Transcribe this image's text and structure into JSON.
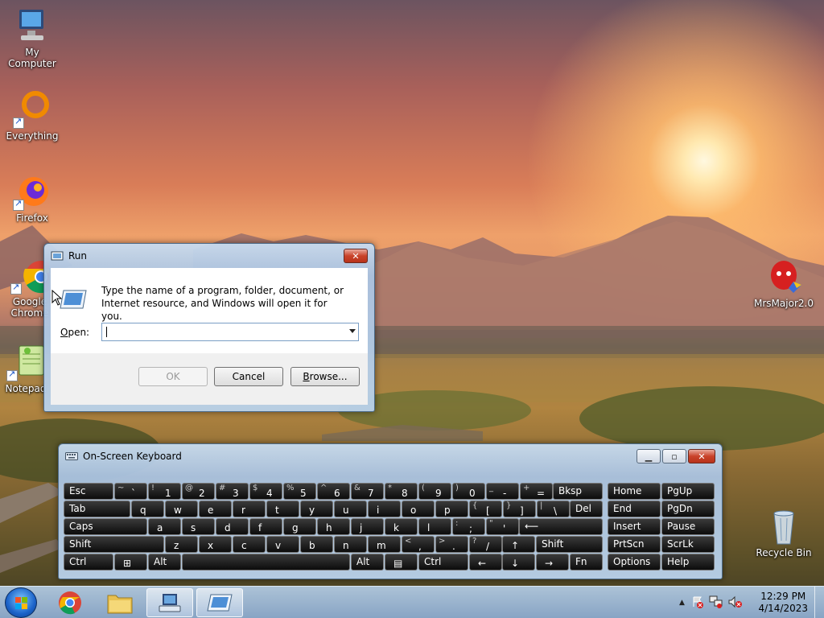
{
  "desktop": {
    "icons": [
      {
        "label": "My Computer"
      },
      {
        "label": "Everything"
      },
      {
        "label": "Firefox"
      },
      {
        "label": "Google Chrome"
      },
      {
        "label": "Notepad"
      },
      {
        "label": "MrsMajor2.0"
      },
      {
        "label": "Recycle Bin"
      }
    ]
  },
  "run_dialog": {
    "title": "Run",
    "description": "Type the name of a program, folder, document, or Internet resource, and Windows will open it for you.",
    "open_label_accel": "O",
    "open_label_rest": "pen:",
    "open_value": "",
    "ok_label": "OK",
    "cancel_label": "Cancel",
    "browse_accel": "B",
    "browse_rest": "rowse..."
  },
  "osk": {
    "title": "On-Screen Keyboard",
    "keys": {
      "esc": "Esc",
      "tab": "Tab",
      "caps": "Caps",
      "shift": "Shift",
      "ctrl": "Ctrl",
      "alt": "Alt",
      "bksp": "Bksp",
      "del": "Del",
      "fn": "Fn",
      "home": "Home",
      "pgup": "PgUp",
      "end": "End",
      "pgdn": "PgDn",
      "insert": "Insert",
      "pause": "Pause",
      "prtscn": "PrtScn",
      "scrlk": "ScrLk",
      "options": "Options",
      "help": "Help",
      "row1": [
        [
          "~",
          "`"
        ],
        [
          "!",
          "1"
        ],
        [
          "@",
          "2"
        ],
        [
          "#",
          "3"
        ],
        [
          "$",
          "4"
        ],
        [
          "%",
          "5"
        ],
        [
          "^",
          "6"
        ],
        [
          "&",
          "7"
        ],
        [
          "*",
          "8"
        ],
        [
          "(",
          "9"
        ],
        [
          ")",
          "0"
        ],
        [
          "_",
          "-"
        ],
        [
          "+",
          "="
        ]
      ],
      "row2": [
        "q",
        "w",
        "e",
        "r",
        "t",
        "y",
        "u",
        "i",
        "o",
        "p"
      ],
      "row2b": [
        [
          "{",
          "["
        ],
        [
          "}",
          "]"
        ],
        [
          "|",
          "\\"
        ]
      ],
      "row3": [
        "a",
        "s",
        "d",
        "f",
        "g",
        "h",
        "j",
        "k",
        "l"
      ],
      "row3b": [
        [
          ":",
          ";"
        ],
        [
          "\"",
          "'"
        ]
      ],
      "row4": [
        "z",
        "x",
        "c",
        "v",
        "b",
        "n",
        "m"
      ],
      "row4b": [
        [
          "<",
          ","
        ],
        [
          ">",
          "."
        ],
        [
          "?",
          "/"
        ]
      ],
      "up": "↑",
      "left": "←",
      "down": "↓",
      "right": "→",
      "enter": "⟵"
    }
  },
  "taskbar": {
    "clock_time": "12:29 PM",
    "clock_date": "4/14/2023",
    "tray_expand": "▲"
  }
}
